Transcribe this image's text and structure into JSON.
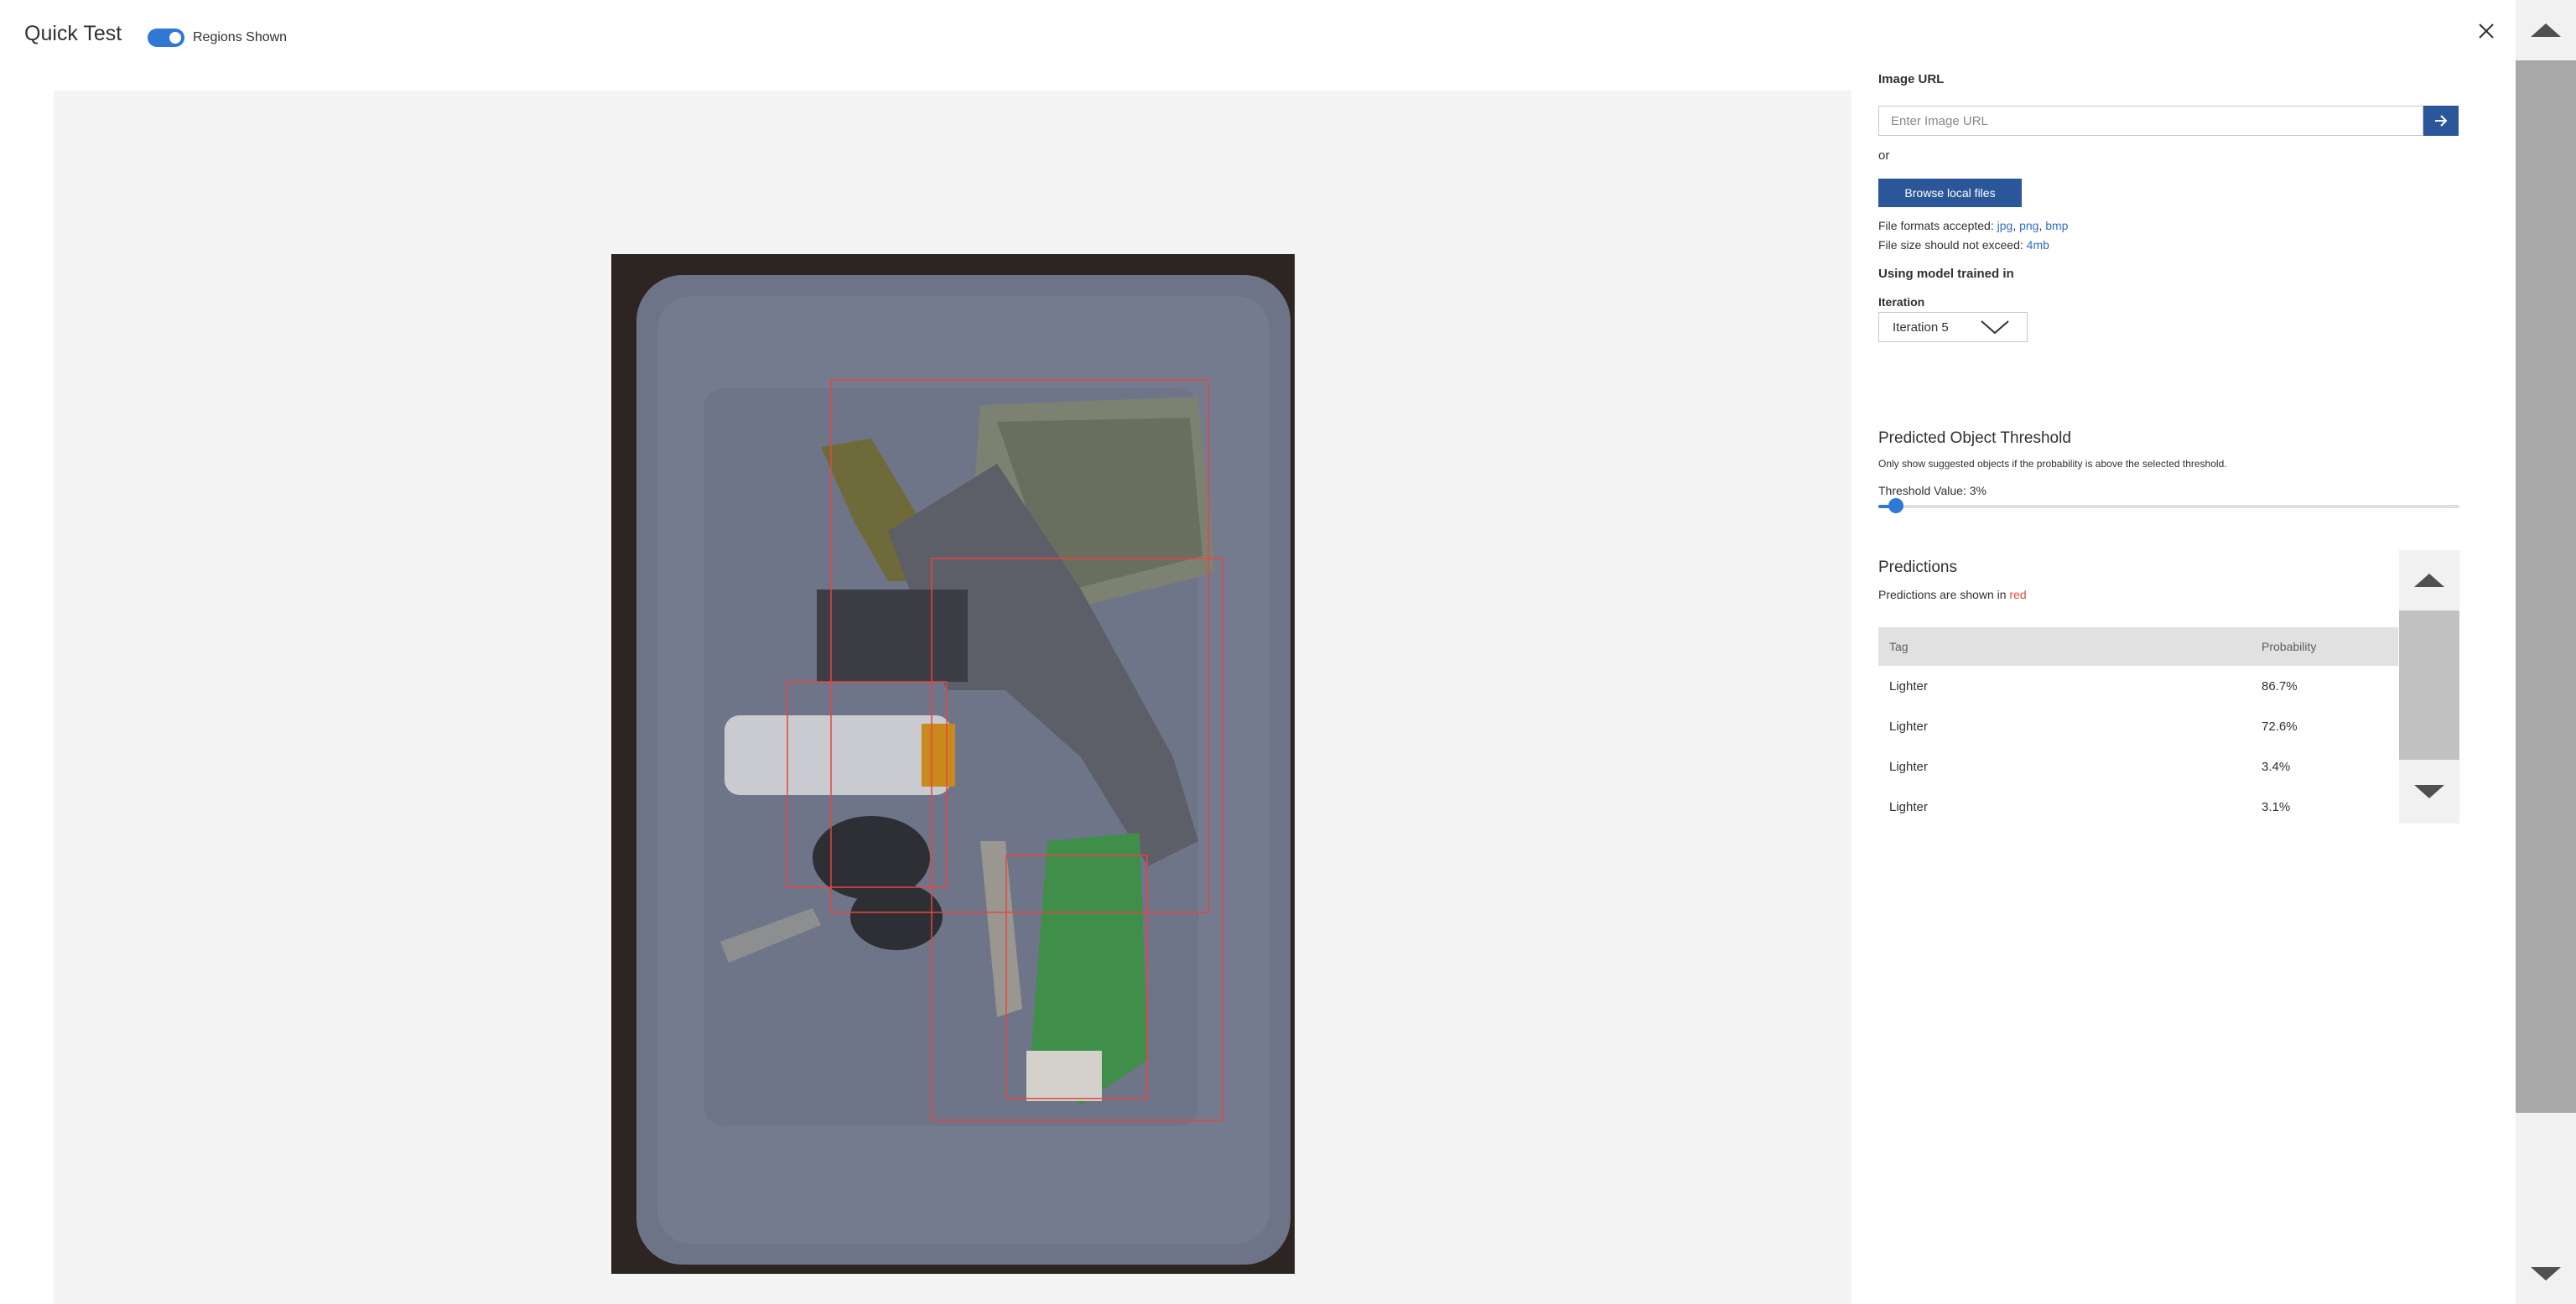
{
  "header": {
    "title": "Quick Test",
    "toggle_label": "Regions Shown",
    "toggle_on": true
  },
  "panel": {
    "image_url_label": "Image URL",
    "image_url_placeholder": "Enter Image URL",
    "image_url_value": "",
    "or_text": "or",
    "browse_button": "Browse local files",
    "formats_prefix": "File formats accepted: ",
    "formats": [
      "jpg",
      "png",
      "bmp"
    ],
    "size_prefix": "File size should not exceed: ",
    "size_limit": "4mb",
    "model_label": "Using model trained in",
    "iteration_label": "Iteration",
    "iteration_selected": "Iteration 5",
    "threshold_title": "Predicted Object Threshold",
    "threshold_help": "Only show suggested objects if the probability is above the selected threshold.",
    "threshold_value_label": "Threshold Value: 3%",
    "threshold_percent": 3,
    "predictions_title": "Predictions",
    "predictions_note_prefix": "Predictions are shown in ",
    "predictions_note_color_word": "red",
    "table": {
      "columns": [
        "Tag",
        "Probability"
      ],
      "rows": [
        {
          "tag": "Lighter",
          "probability": "86.7%"
        },
        {
          "tag": "Lighter",
          "probability": "72.6%"
        },
        {
          "tag": "Lighter",
          "probability": "3.4%"
        },
        {
          "tag": "Lighter",
          "probability": "3.1%"
        }
      ]
    }
  },
  "colors": {
    "accent": "#2b579a",
    "toggle": "#2f78d6",
    "link": "#2f6ecb",
    "prediction": "#e8453c"
  },
  "icons": {
    "close": "close-icon",
    "go": "arrow-right-icon",
    "dropdown": "chevron-down-icon",
    "scroll_up": "triangle-up-icon",
    "scroll_down": "triangle-down-icon"
  }
}
